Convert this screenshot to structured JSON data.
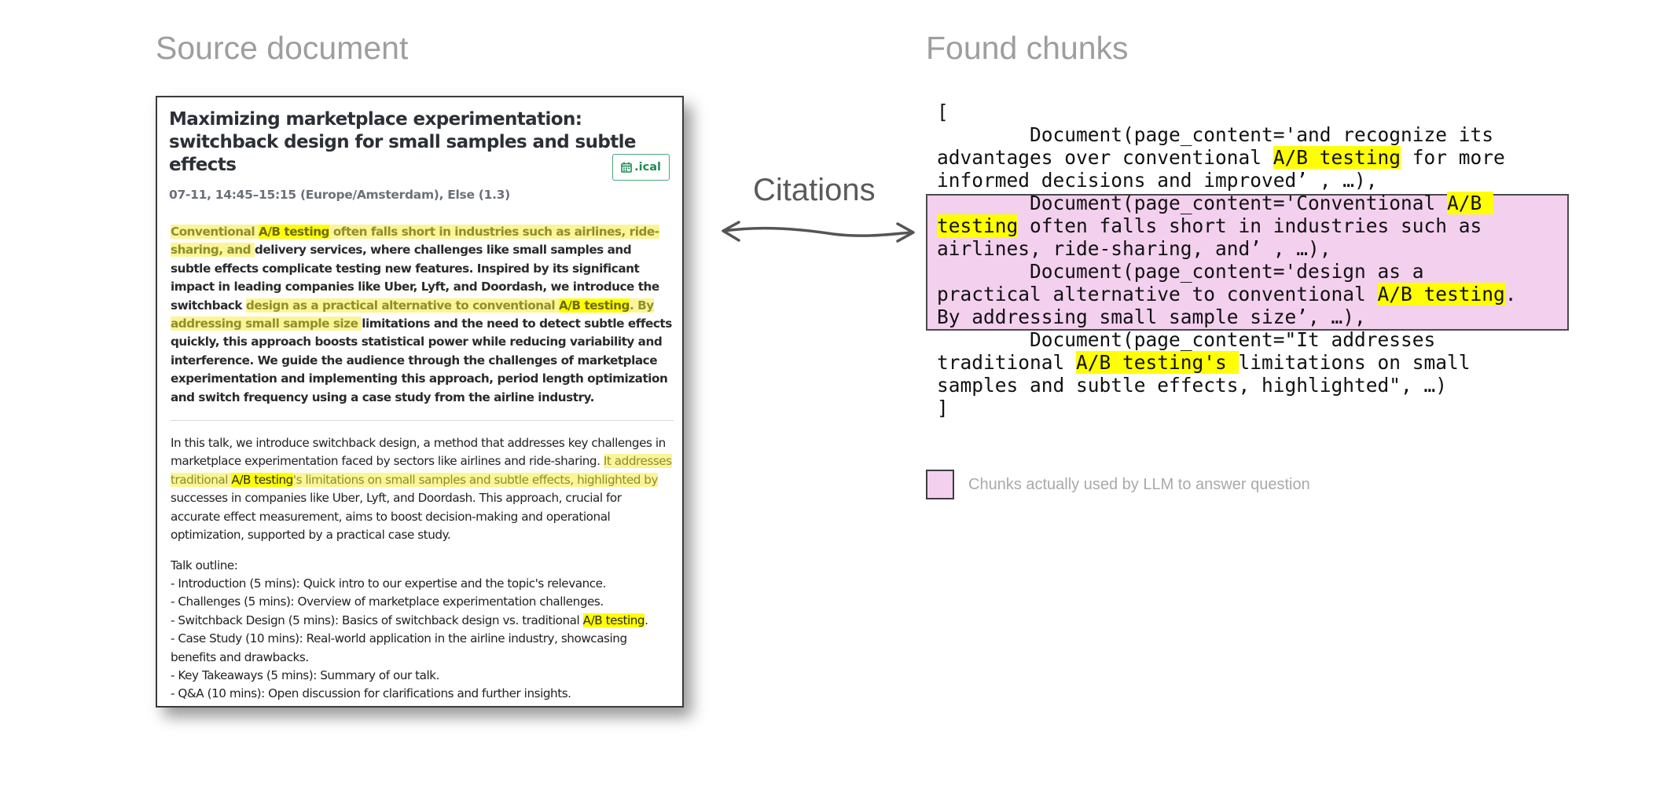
{
  "headings": {
    "source_document": "Source document",
    "found_chunks": "Found chunks",
    "citations": "Citations"
  },
  "document": {
    "title": "Maximizing marketplace experimentation: switchback design for small samples and subtle effects",
    "ical_label": ".ical",
    "meta": "07-11, 14:45–15:15 (Europe/Amsterdam), Else (1.3)",
    "abstract": {
      "hl1_a": "Conventional ",
      "hl1_b": "A/B testing",
      "hl1_c": " often falls short in industries such as airlines, ride-sharing, and ",
      "t1": "delivery services, where challenges like small samples and subtle effects complicate testing new features. Inspired by its significant impact in leading companies like Uber, Lyft, and Doordash, we introduce the switchback ",
      "hl2_a": "design as a practical alternative to conventional ",
      "hl2_b": "A/B testing",
      "hl2_c": ". By addressing small sample size ",
      "t2": "limitations and the need to detect subtle effects quickly, this approach boosts statistical power while reducing variability and interference. We guide the audience through the challenges of marketplace experimentation and implementing this approach, period length optimization and switch frequency using a case study from the airline industry."
    },
    "description": {
      "t1": "In this talk, we introduce switchback design, a method that addresses key challenges in marketplace experimentation faced by sectors like airlines and ride-sharing. ",
      "hl_a": "It addresses traditional ",
      "hl_b": "A/B testing",
      "hl_c": "'s limitations on small samples and subtle effects, highlighted by",
      "t2": " successes in companies like Uber, Lyft, and Doordash. This approach, crucial for accurate effect measurement, aims to boost decision-making and operational optimization, supported by a practical case study."
    },
    "outline": {
      "heading": "Talk outline:",
      "item1": "- Introduction (5 mins): Quick intro to our expertise and the topic's relevance.",
      "item2": "- Challenges (5 mins): Overview of marketplace experimentation challenges.",
      "item3_a": "- Switchback Design (5 mins): Basics of switchback design vs. traditional ",
      "item3_b": "A/B testing",
      "item3_c": ".",
      "item4": "- Case Study (10 mins): Real-world application in the airline industry, showcasing benefits and drawbacks.",
      "item5": "- Key Takeaways (5 mins): Summary of our talk.",
      "item6": "- Q&A (10 mins): Open discussion for clarifications and further insights."
    }
  },
  "code": {
    "open": "[",
    "c1_l1": "        Document(page_content='and recognize its",
    "c1_l2_a": "advantages over conventional ",
    "c1_l2_b": "A/B testing",
    "c1_l2_c": " for more",
    "c1_l3": "informed decisions and improved’ , …),",
    "c2_l1_a": "        Document(page_content='Conventional ",
    "c2_l1_b": "A/B ",
    "c2_l2_a": "testing",
    "c2_l2_b": " often falls short in industries such as",
    "c2_l3": "airlines, ride-sharing, and’ , …),",
    "c3_l1": "        Document(page_content='design as a",
    "c3_l2_a": "practical alternative to conventional ",
    "c3_l2_b": "A/B testing",
    "c3_l2_c": ".",
    "c3_l3": "By addressing small sample size’, …),",
    "c4_l1": "        Document(page_content=\"It addresses",
    "c4_l2_a": "traditional ",
    "c4_l2_b": "A/B testing's ",
    "c4_l2_c": "limitations on small",
    "c4_l3": "samples and subtle effects, highlighted\", …)",
    "close": "]"
  },
  "legend": {
    "label": "Chunks actually used by LLM to answer question",
    "swatch_color": "#f3d0ee"
  },
  "colors": {
    "highlight": "#ffff00",
    "soft_highlight": "#fbf597",
    "used_chunk": "#f3d0ee",
    "ical_accent": "#1f8a58"
  },
  "icons": {
    "ical": "calendar-icon",
    "arrow": "double-headed-arrow"
  }
}
